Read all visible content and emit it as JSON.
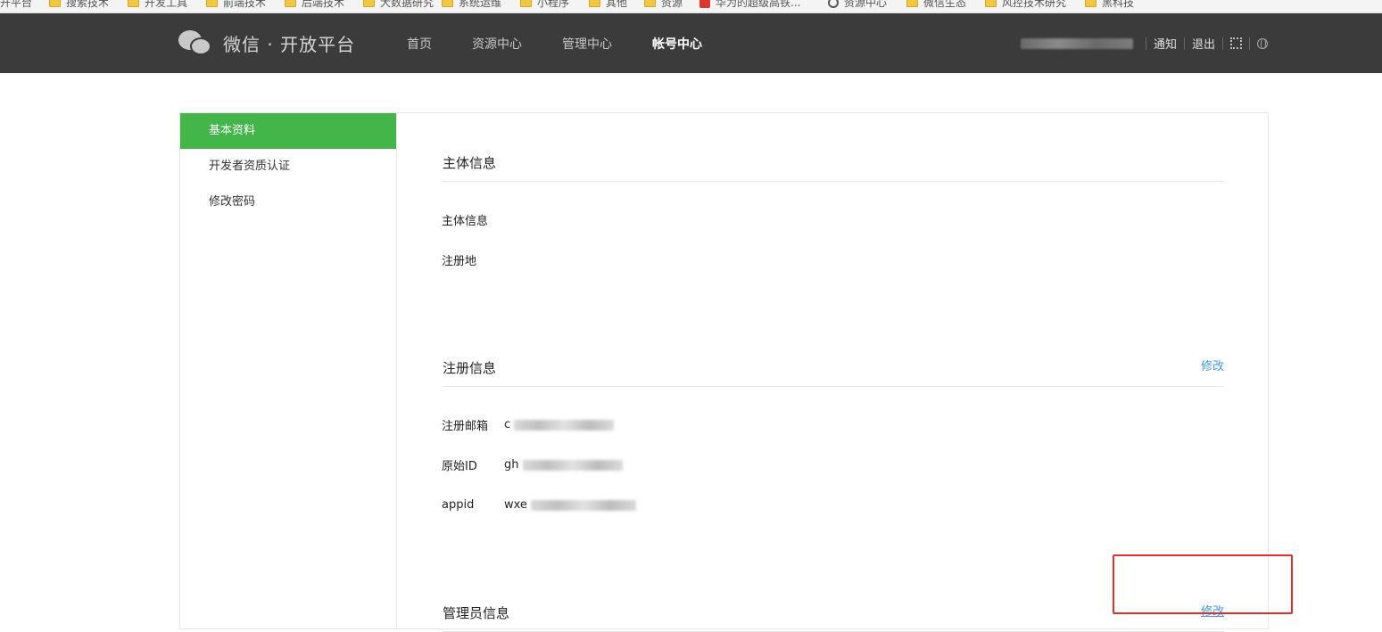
{
  "bookmarks": [
    {
      "label": "开平台",
      "icon": "none"
    },
    {
      "label": "搜索技术",
      "icon": "folder-icon"
    },
    {
      "label": "开发工具",
      "icon": "folder-icon"
    },
    {
      "label": "前端技术",
      "icon": "folder-icon"
    },
    {
      "label": "后端技术",
      "icon": "folder-icon"
    },
    {
      "label": "大数据研究",
      "icon": "folder-icon"
    },
    {
      "label": "系统运维",
      "icon": "folder-icon"
    },
    {
      "label": "小程序",
      "icon": "folder-icon"
    },
    {
      "label": "其他",
      "icon": "folder-icon"
    },
    {
      "label": "资源",
      "icon": "folder-icon"
    },
    {
      "label": "华为的超级高铁...",
      "icon": "red-favicon"
    },
    {
      "label": "资源中心",
      "icon": "globe-icon"
    },
    {
      "label": "微信生态",
      "icon": "folder-icon"
    },
    {
      "label": "风控技术研究",
      "icon": "folder-icon"
    },
    {
      "label": "黑科技",
      "icon": "folder-icon"
    }
  ],
  "header": {
    "logo_text": "微信 · 开放平台",
    "nav": [
      {
        "label": "首页",
        "active": false
      },
      {
        "label": "资源中心",
        "active": false
      },
      {
        "label": "管理中心",
        "active": false
      },
      {
        "label": "帐号中心",
        "active": true
      }
    ],
    "user": {
      "notify_label": "通知",
      "logout_label": "退出"
    }
  },
  "sidebar": {
    "items": [
      {
        "label": "基本资料",
        "active": true
      },
      {
        "label": "开发者资质认证",
        "active": false
      },
      {
        "label": "修改密码",
        "active": false
      }
    ]
  },
  "main": {
    "subject": {
      "title": "主体信息",
      "rows": [
        {
          "label": "主体信息",
          "value": ""
        },
        {
          "label": "注册地",
          "value": ""
        }
      ]
    },
    "registration": {
      "title": "注册信息",
      "edit_label": "修改",
      "rows": [
        {
          "label": "注册邮箱",
          "value_prefix": "c"
        },
        {
          "label": "原始ID",
          "value_prefix": "gh"
        },
        {
          "label": "appid",
          "value_prefix": "wxe"
        }
      ]
    },
    "admin": {
      "title": "管理员信息",
      "edit_label": "修改"
    }
  },
  "colors": {
    "topbar": "#3b3b3b",
    "sidebar_active": "#44b549",
    "link": "#459ae9",
    "highlight": "#e02f2f"
  }
}
